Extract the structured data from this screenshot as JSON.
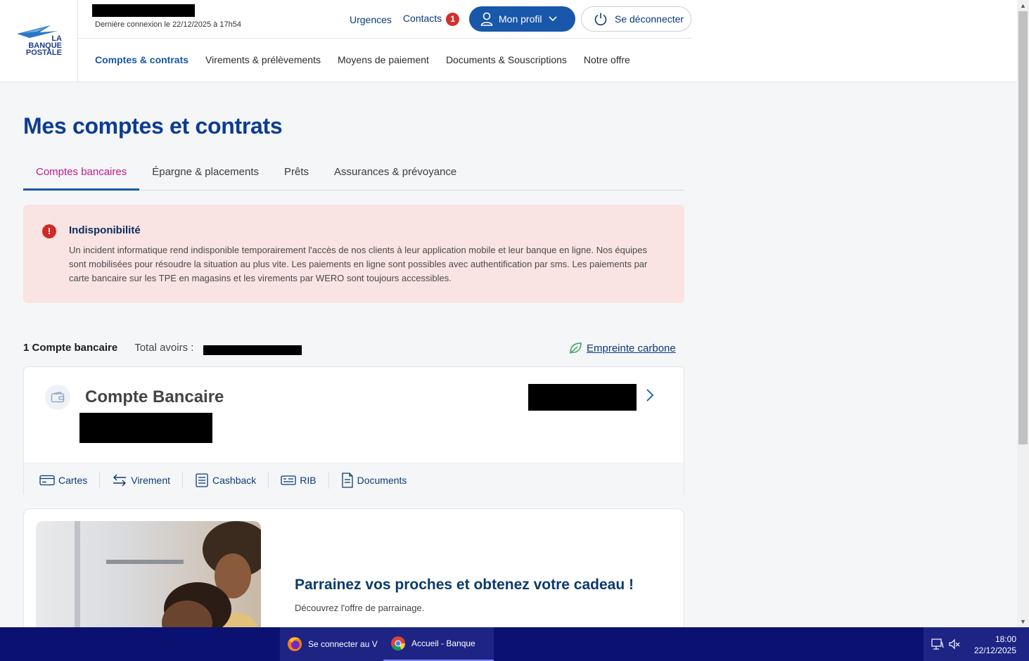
{
  "header": {
    "logo": {
      "line1": "LA",
      "line2": "BANQUE",
      "line3": "POSTALE"
    },
    "last_login": "Dernière connexion le 22/12/2025 à 17h54",
    "urgences": "Urgences",
    "contacts": "Contacts",
    "contacts_badge": "1",
    "profile_label": "Mon profil",
    "logout_label": "Se déconnecter",
    "nav": [
      {
        "label": "Comptes & contrats"
      },
      {
        "label": "Virements & prélèvements"
      },
      {
        "label": "Moyens de paiement"
      },
      {
        "label": "Documents & Souscriptions"
      },
      {
        "label": "Notre offre"
      }
    ]
  },
  "page": {
    "title": "Mes comptes et contrats",
    "tabs": [
      {
        "label": "Comptes bancaires"
      },
      {
        "label": "Épargne & placements"
      },
      {
        "label": "Prêts"
      },
      {
        "label": "Assurances & prévoyance"
      }
    ]
  },
  "alert": {
    "icon": "!",
    "title": "Indisponibilité",
    "body": "Un incident informatique rend indisponible temporairement l'accès de nos clients à leur application mobile et leur banque en ligne. Nos équipes sont mobilisées pour résoudre la situation au plus vite. Les paiements en ligne sont possibles avec authentification par sms. Les paiements par carte bancaire sur les TPE en magasins et les virements par WERO sont toujours accessibles."
  },
  "summary": {
    "count_label": "1 Compte bancaire",
    "total_label": "Total avoirs :",
    "carbon_label": "Empreinte carbone"
  },
  "account": {
    "name": "Compte Bancaire",
    "actions": [
      {
        "label": "Cartes",
        "icon": "card-icon"
      },
      {
        "label": "Virement",
        "icon": "transfer-icon"
      },
      {
        "label": "Cashback",
        "icon": "receipt-icon"
      },
      {
        "label": "RIB",
        "icon": "id-card-icon"
      },
      {
        "label": "Documents",
        "icon": "document-icon"
      }
    ]
  },
  "promo": {
    "title": "Parrainez vos proches et obtenez votre cadeau !",
    "subtitle": "Découvrez l'offre de parrainage."
  },
  "taskbar": {
    "tasks": [
      {
        "label": "Se connecter au V",
        "icon": "firefox-icon"
      },
      {
        "label": "Accueil - Banque",
        "icon": "chrome-icon"
      }
    ],
    "time": "18:00",
    "date": "22/12/2025"
  },
  "colors": {
    "brand_blue": "#0b3d91",
    "button_blue": "#1857a9",
    "active_tab_pink": "#c0198c",
    "alert_bg": "#f9e3e3",
    "alert_red": "#cf2a2a",
    "taskbar": "#0a1170"
  }
}
